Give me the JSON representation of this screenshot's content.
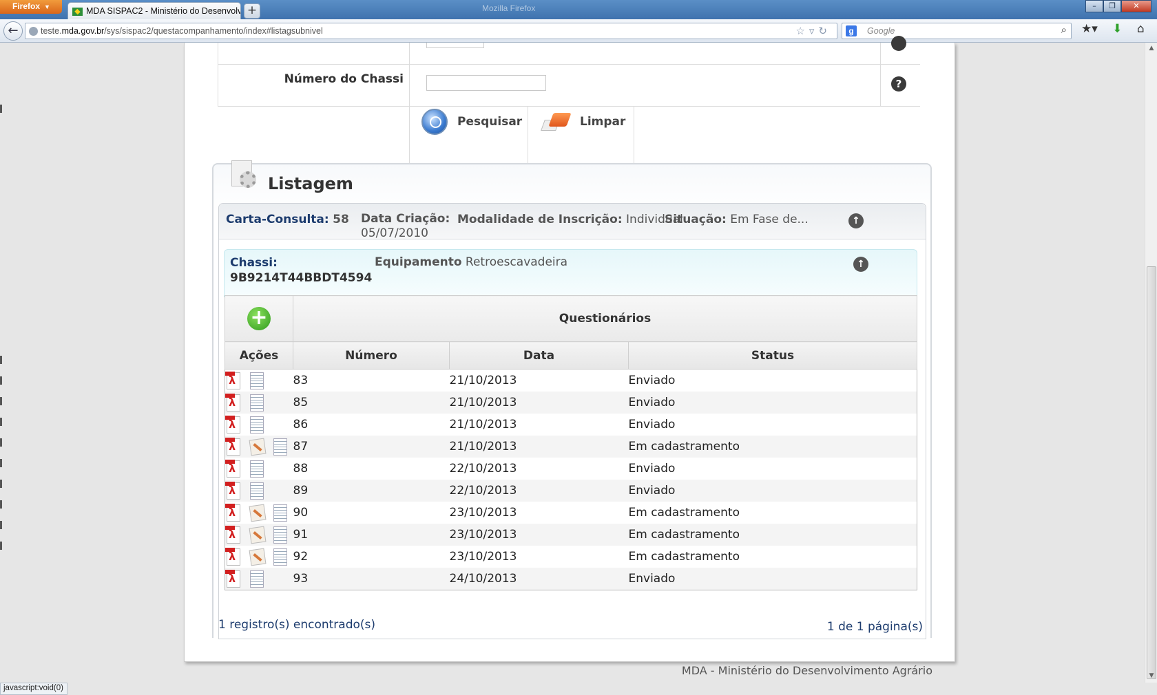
{
  "browser": {
    "app_button": "Firefox",
    "tab_title": "MDA SISPAC2 - Ministério do Desenvolv...",
    "new_tab": "+",
    "window_title": "Mozilla Firefox",
    "url_prefix": "teste.",
    "url_host": "mda.gov.br",
    "url_path": "/sys/sispac2/questacompanhamento/index#listagsubnivel",
    "search_placeholder": "Google",
    "status_text": "javascript:void(0)"
  },
  "form": {
    "chassi_label": "Número do Chassi",
    "chassi_value": "",
    "help_glyph": "?",
    "search_button": "Pesquisar",
    "clear_button": "Limpar"
  },
  "listagem": {
    "title": "Listagem",
    "carta_label": "Carta-Consulta:",
    "carta_value": "58",
    "data_label": "Data Criação:",
    "data_value": "05/07/2010",
    "modalidade_label": "Modalidade de Inscrição:",
    "modalidade_value": "Individual",
    "situacao_label": "Situação:",
    "situacao_value": "Em Fase de...",
    "chassi_label": "Chassi:",
    "chassi_value": "9B9214T44BBDT4594",
    "equipamento_label": "Equipamento",
    "equipamento_value": "Retroescavadeira"
  },
  "table": {
    "title": "Questionários",
    "columns": [
      "Ações",
      "Número",
      "Data",
      "Status"
    ],
    "rows": [
      {
        "numero": "83",
        "data": "21/10/2013",
        "status": "Enviado",
        "editable": false
      },
      {
        "numero": "85",
        "data": "21/10/2013",
        "status": "Enviado",
        "editable": false
      },
      {
        "numero": "86",
        "data": "21/10/2013",
        "status": "Enviado",
        "editable": false
      },
      {
        "numero": "87",
        "data": "21/10/2013",
        "status": "Em cadastramento",
        "editable": true
      },
      {
        "numero": "88",
        "data": "22/10/2013",
        "status": "Enviado",
        "editable": false
      },
      {
        "numero": "89",
        "data": "22/10/2013",
        "status": "Enviado",
        "editable": false
      },
      {
        "numero": "90",
        "data": "23/10/2013",
        "status": "Em cadastramento",
        "editable": true
      },
      {
        "numero": "91",
        "data": "23/10/2013",
        "status": "Em cadastramento",
        "editable": true
      },
      {
        "numero": "92",
        "data": "23/10/2013",
        "status": "Em cadastramento",
        "editable": true
      },
      {
        "numero": "93",
        "data": "24/10/2013",
        "status": "Enviado",
        "editable": false
      }
    ]
  },
  "footer": {
    "records": "1 registro(s) encontrado(s)",
    "pages": "1 de 1 página(s)",
    "copyright": "MDA - Ministério do Desenvolvimento Agrário"
  },
  "icons": {
    "back": "back-arrow-icon",
    "search": "magnifier-icon",
    "clear": "eraser-icon",
    "add": "plus-icon",
    "collapse": "arrow-up-icon",
    "pdf": "pdf-icon",
    "edit": "edit-icon",
    "view": "list-icon"
  },
  "colors": {
    "navy_label": "#1d3c6e",
    "add_green": "#2f9a1d",
    "pdf_red": "#d21f1f"
  }
}
